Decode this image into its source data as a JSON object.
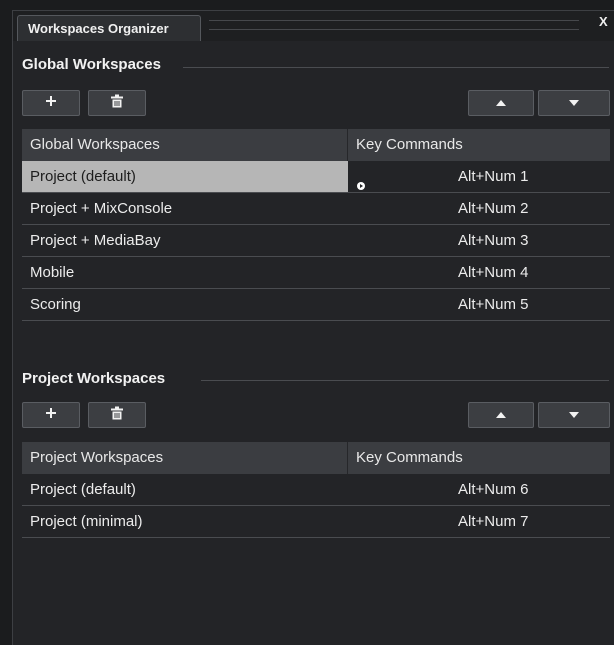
{
  "window": {
    "tab_label": "Workspaces Organizer",
    "close_label": "X"
  },
  "global": {
    "section_title": "Global Workspaces",
    "columns": [
      "Global Workspaces",
      "Key Commands"
    ],
    "rows": [
      {
        "name": "Project (default)",
        "key": "Alt+Num 1",
        "selected": true,
        "active": true
      },
      {
        "name": "Project + MixConsole",
        "key": "Alt+Num 2"
      },
      {
        "name": "Project + MediaBay",
        "key": "Alt+Num 3"
      },
      {
        "name": "Mobile",
        "key": "Alt+Num 4"
      },
      {
        "name": "Scoring",
        "key": "Alt+Num 5"
      }
    ]
  },
  "project": {
    "section_title": "Project Workspaces",
    "columns": [
      "Project Workspaces",
      "Key Commands"
    ],
    "rows": [
      {
        "name": "Project (default)",
        "key": "Alt+Num 6"
      },
      {
        "name": "Project (minimal)",
        "key": "Alt+Num 7"
      }
    ]
  },
  "icons": {
    "add": "plus-icon",
    "delete": "trash-icon",
    "move_up": "arrow-up-icon",
    "move_down": "arrow-down-icon",
    "active": "active-workspace-icon"
  },
  "colors": {
    "background": "#232427",
    "header": "#3b3d41",
    "selection": "#b6b6b6"
  }
}
